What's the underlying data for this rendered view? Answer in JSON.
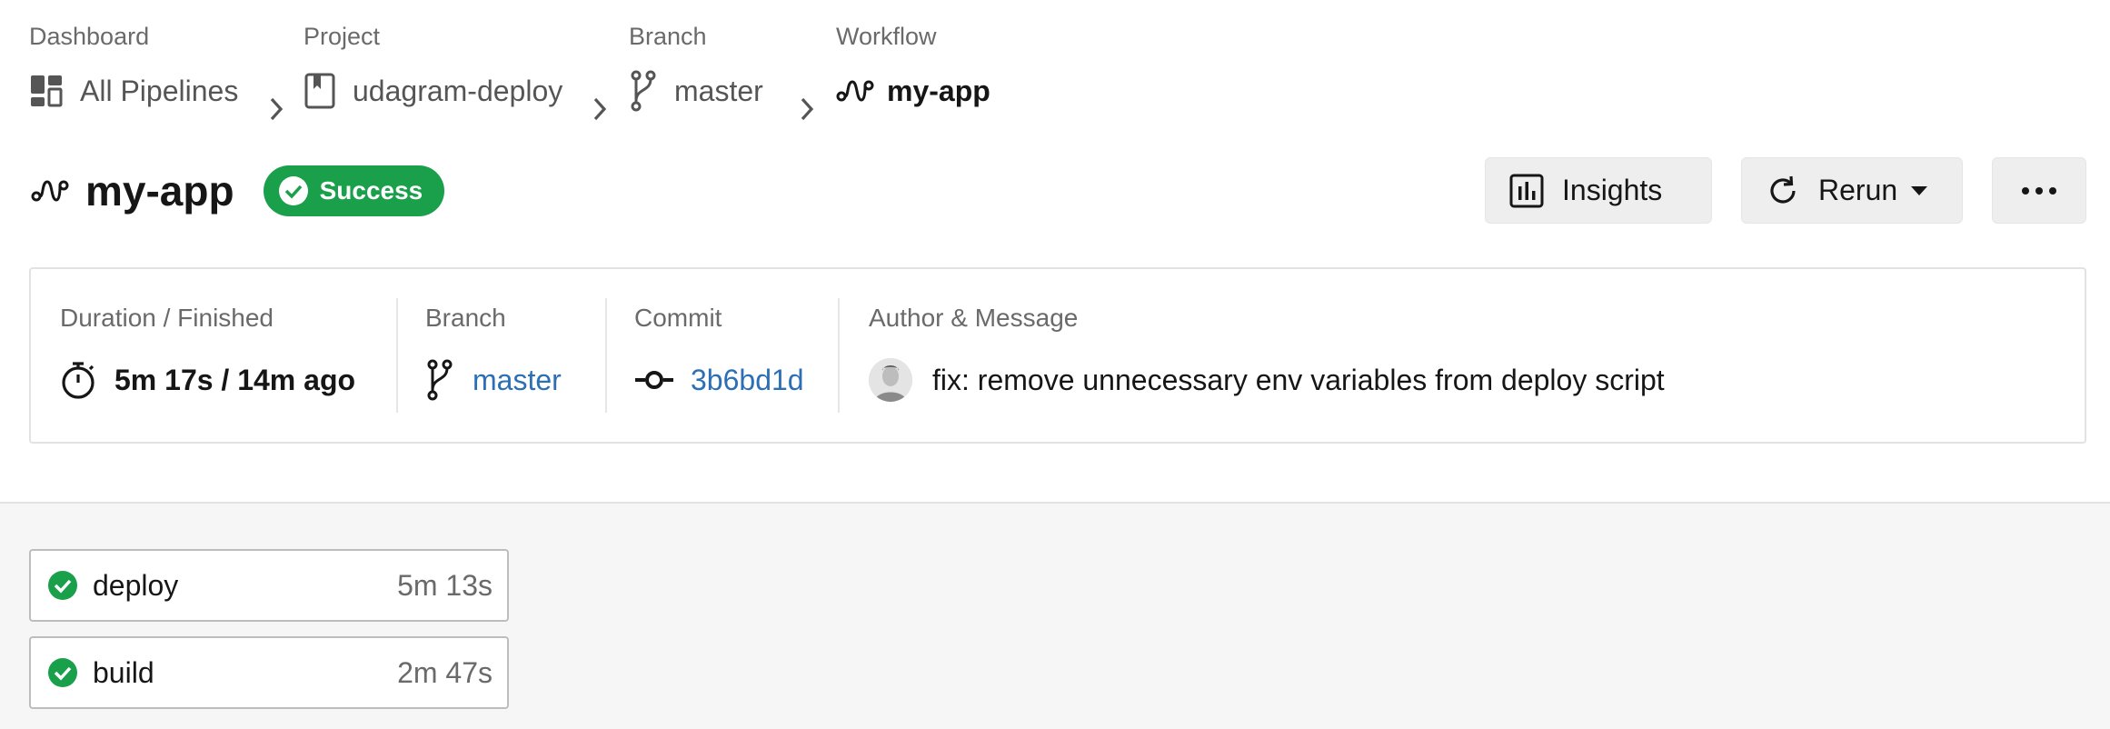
{
  "breadcrumb": {
    "dashboard": {
      "label": "Dashboard",
      "value": "All Pipelines"
    },
    "project": {
      "label": "Project",
      "value": "udagram-deploy"
    },
    "branch": {
      "label": "Branch",
      "value": "master"
    },
    "workflow": {
      "label": "Workflow",
      "value": "my-app"
    }
  },
  "header": {
    "title": "my-app",
    "status": "Success",
    "status_color": "#1aa04b",
    "insights_label": "Insights",
    "rerun_label": "Rerun",
    "more_icon": "ellipsis-icon"
  },
  "summary": {
    "duration": {
      "label": "Duration / Finished",
      "value": "5m 17s / 14m ago"
    },
    "branch": {
      "label": "Branch",
      "value": "master"
    },
    "commit": {
      "label": "Commit",
      "value": "3b6bd1d"
    },
    "author": {
      "label": "Author & Message",
      "message": "fix: remove unnecessary env variables from deploy script"
    }
  },
  "jobs": [
    {
      "name": "deploy",
      "duration": "5m 13s",
      "status": "success"
    },
    {
      "name": "build",
      "duration": "2m 47s",
      "status": "success"
    }
  ],
  "colors": {
    "link": "#2c6fb5",
    "success": "#1aa04b"
  }
}
